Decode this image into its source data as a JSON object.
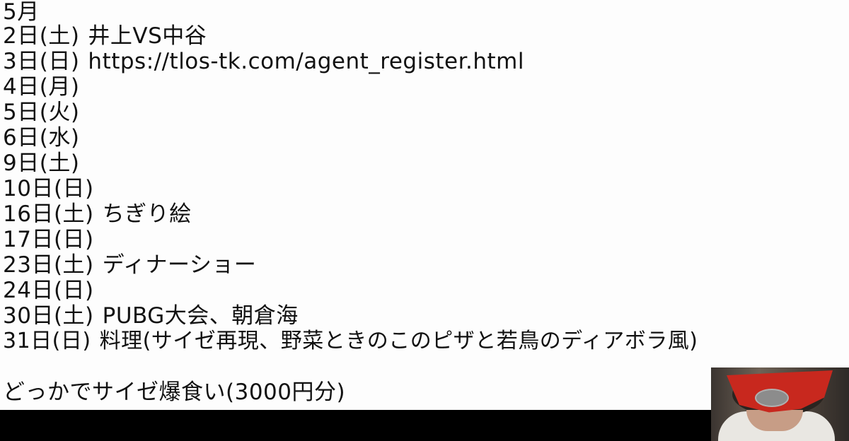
{
  "schedule": {
    "month": "5月",
    "entries": [
      {
        "day": "2日(土)",
        "event": "井上VS中谷"
      },
      {
        "day": "3日(日)",
        "event": "https://tlos-tk.com/agent_register.html"
      },
      {
        "day": "4日(月)",
        "event": ""
      },
      {
        "day": "5日(火)",
        "event": ""
      },
      {
        "day": "6日(水)",
        "event": ""
      },
      {
        "day": "9日(土)",
        "event": ""
      },
      {
        "day": "10日(日)",
        "event": ""
      },
      {
        "day": "16日(土)",
        "event": "ちぎり絵"
      },
      {
        "day": "17日(日)",
        "event": ""
      },
      {
        "day": "23日(土)",
        "event": "ディナーショー"
      },
      {
        "day": "24日(日)",
        "event": ""
      },
      {
        "day": "30日(土)",
        "event": "PUBG大会、朝倉海"
      },
      {
        "day": "31日(日)",
        "event": "料理(サイゼ再現、野菜ときのこのピザと若鳥のディアボラ風)"
      }
    ],
    "footer_note": "どっかでサイゼ爆食い(3000円分)"
  },
  "colors": {
    "background": "#fdfdfd",
    "text": "#111111",
    "bottom_bar": "#000000",
    "mask_red": "#c8281e"
  }
}
